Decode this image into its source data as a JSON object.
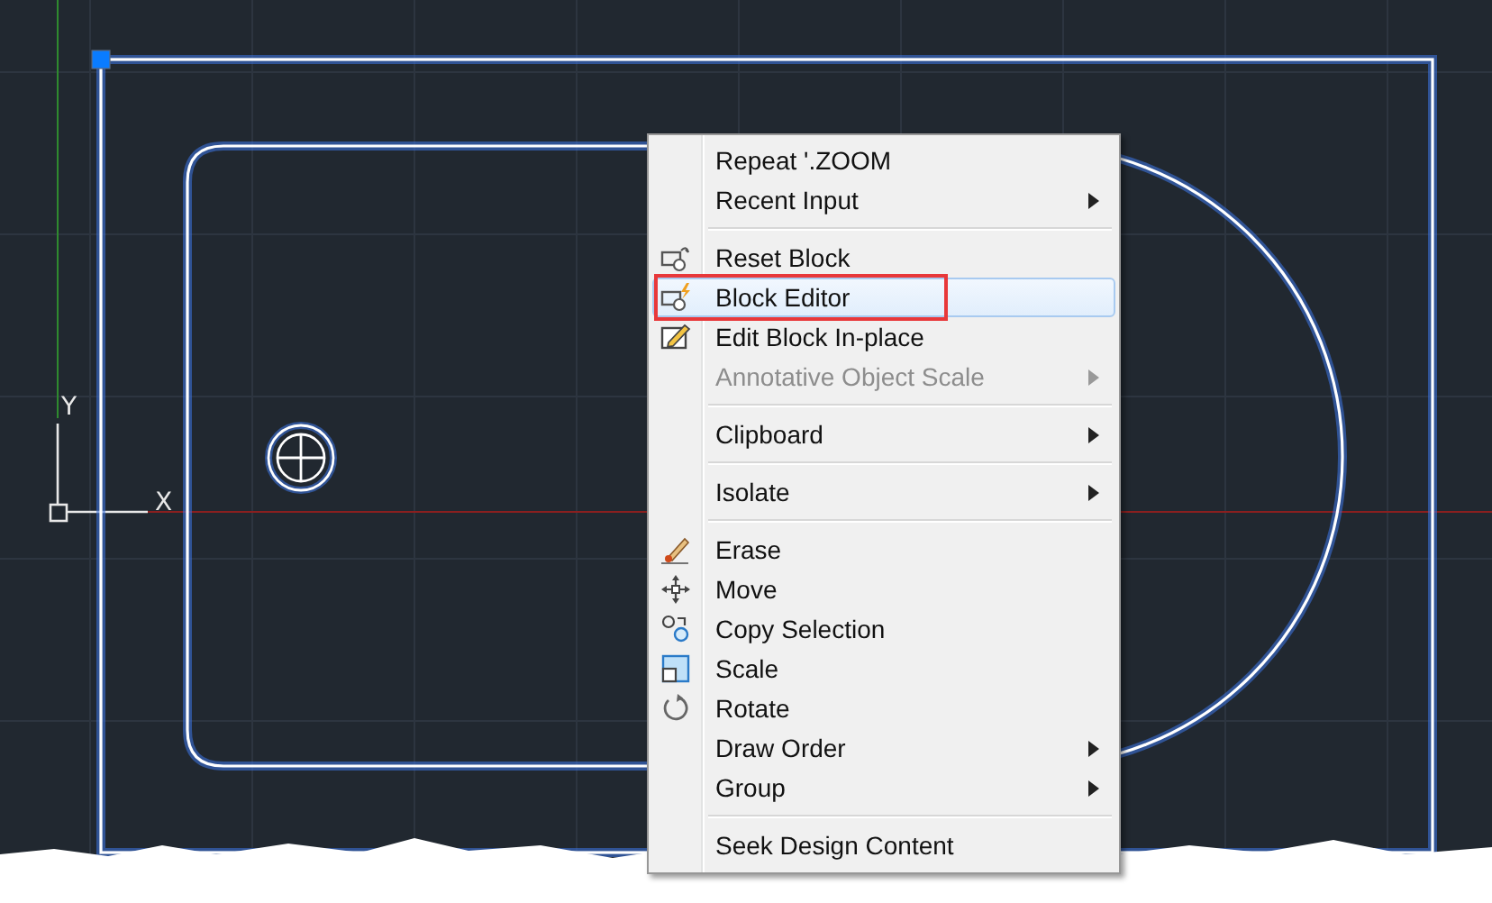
{
  "canvas": {
    "ucs": {
      "y_label": "Y",
      "x_label": "X"
    }
  },
  "context_menu": {
    "items": [
      {
        "kind": "command",
        "label": "Repeat '.ZOOM",
        "submenu": false,
        "disabled": false,
        "selected": false,
        "annotated": false
      },
      {
        "kind": "command",
        "label": "Recent Input",
        "submenu": true,
        "disabled": false,
        "selected": false,
        "annotated": false
      },
      {
        "kind": "separator"
      },
      {
        "kind": "command",
        "label": "Reset Block",
        "submenu": false,
        "disabled": false,
        "selected": false,
        "annotated": false
      },
      {
        "kind": "command",
        "label": "Block Editor",
        "submenu": false,
        "disabled": false,
        "selected": true,
        "annotated": true
      },
      {
        "kind": "command",
        "label": "Edit Block In-place",
        "submenu": false,
        "disabled": false,
        "selected": false,
        "annotated": false
      },
      {
        "kind": "command",
        "label": "Annotative Object Scale",
        "submenu": true,
        "disabled": true,
        "selected": false,
        "annotated": false
      },
      {
        "kind": "separator"
      },
      {
        "kind": "command",
        "label": "Clipboard",
        "submenu": true,
        "disabled": false,
        "selected": false,
        "annotated": false
      },
      {
        "kind": "separator"
      },
      {
        "kind": "command",
        "label": "Isolate",
        "submenu": true,
        "disabled": false,
        "selected": false,
        "annotated": false
      },
      {
        "kind": "separator"
      },
      {
        "kind": "command",
        "label": "Erase",
        "submenu": false,
        "disabled": false,
        "selected": false,
        "annotated": false
      },
      {
        "kind": "command",
        "label": "Move",
        "submenu": false,
        "disabled": false,
        "selected": false,
        "annotated": false
      },
      {
        "kind": "command",
        "label": "Copy Selection",
        "submenu": false,
        "disabled": false,
        "selected": false,
        "annotated": false
      },
      {
        "kind": "command",
        "label": "Scale",
        "submenu": false,
        "disabled": false,
        "selected": false,
        "annotated": false
      },
      {
        "kind": "command",
        "label": "Rotate",
        "submenu": false,
        "disabled": false,
        "selected": false,
        "annotated": false
      },
      {
        "kind": "command",
        "label": "Draw Order",
        "submenu": true,
        "disabled": false,
        "selected": false,
        "annotated": false
      },
      {
        "kind": "command",
        "label": "Group",
        "submenu": true,
        "disabled": false,
        "selected": false,
        "annotated": false
      },
      {
        "kind": "separator"
      },
      {
        "kind": "command",
        "label": "Seek Design Content",
        "submenu": false,
        "disabled": false,
        "selected": false,
        "annotated": false
      }
    ]
  }
}
